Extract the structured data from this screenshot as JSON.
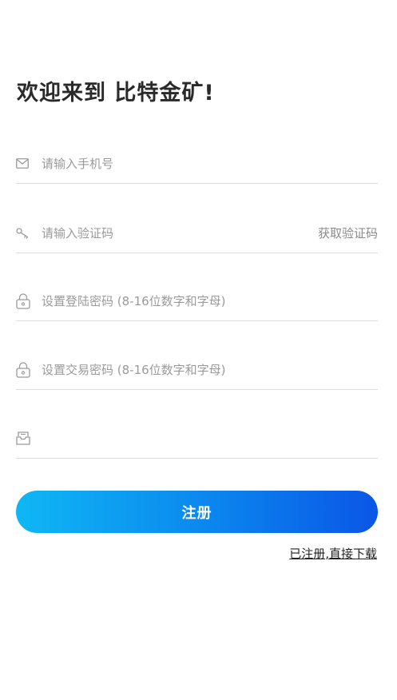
{
  "header": {
    "welcome": "欢迎来到 比特金矿!"
  },
  "form": {
    "phone": {
      "icon": "mail-icon",
      "placeholder": "请输入手机号",
      "value": ""
    },
    "code": {
      "icon": "key-icon",
      "placeholder": "请输入验证码",
      "value": "",
      "get_code_label": "获取验证码"
    },
    "login_password": {
      "icon": "lock-icon",
      "placeholder": "设置登陆密码 (8-16位数字和字母)",
      "value": ""
    },
    "trade_password": {
      "icon": "lock-icon",
      "placeholder": "设置交易密码 (8-16位数字和字母)",
      "value": ""
    },
    "invite_code": {
      "icon": "inbox-icon",
      "placeholder": "",
      "value": ""
    }
  },
  "actions": {
    "register_label": "注册",
    "download_link": "已注册,直接下载"
  },
  "colors": {
    "button_gradient_start": "#0fb7f4",
    "button_gradient_end": "#0b56e6",
    "divider": "#dcdcdc",
    "placeholder": "#9a9a9a"
  }
}
